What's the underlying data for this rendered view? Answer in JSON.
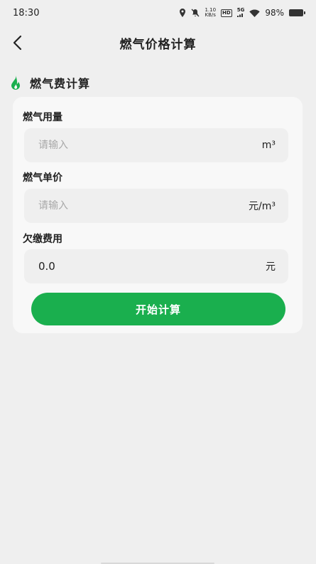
{
  "status_bar": {
    "time": "18:30",
    "net_speed_value": "1.10",
    "net_speed_unit": "KB/s",
    "hd": "HD",
    "network": "5G",
    "battery": "98%"
  },
  "nav": {
    "title": "燃气价格计算",
    "back_icon": "chevron-left-icon"
  },
  "section": {
    "icon": "flame-icon",
    "title": "燃气费计算"
  },
  "form": {
    "usage": {
      "label": "燃气用量",
      "placeholder": "请输入",
      "unit": "m³"
    },
    "price": {
      "label": "燃气单价",
      "placeholder": "请输入",
      "unit": "元/m³"
    },
    "owed": {
      "label": "欠缴费用",
      "value": "0.0",
      "unit": "元"
    }
  },
  "calc_button_label": "开始计算",
  "colors": {
    "accent": "#1aaf4e",
    "background": "#efefef",
    "card": "#f8f8f8"
  }
}
